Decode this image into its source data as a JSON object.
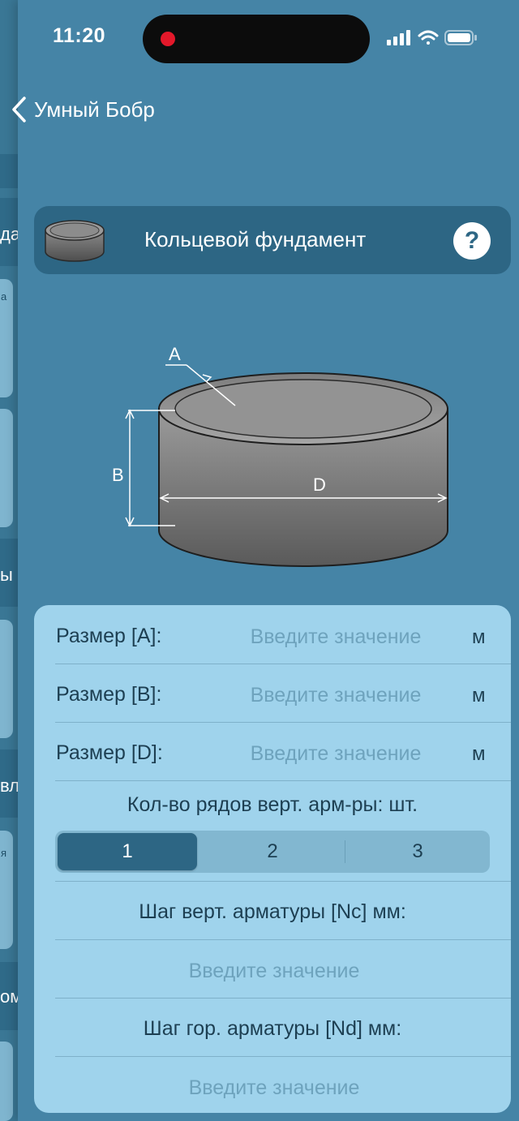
{
  "status_bar": {
    "time": "11:20"
  },
  "nav": {
    "back_label": "Умный Бобр"
  },
  "header": {
    "title": "Кольцевой фундамент",
    "help_label": "?"
  },
  "diagram": {
    "label_a": "A",
    "label_b": "B",
    "label_d": "D"
  },
  "underlying_screen": {
    "fragments": [
      "да",
      "а",
      "ы",
      "вл",
      "я",
      "ом"
    ]
  },
  "form": {
    "size_a": {
      "label": "Размер [A]:",
      "placeholder": "Введите значение",
      "unit": "м"
    },
    "size_b": {
      "label": "Размер [B]:",
      "placeholder": "Введите значение",
      "unit": "м"
    },
    "size_d": {
      "label": "Размер [D]:",
      "placeholder": "Введите значение",
      "unit": "м"
    },
    "rows_label": "Кол-во рядов верт. арм-ры: шт.",
    "rows_options": [
      "1",
      "2",
      "3"
    ],
    "rows_selected": "1",
    "vert_step_label": "Шаг верт. арматуры [Nc] мм:",
    "vert_step_placeholder": "Введите значение",
    "hor_step_label": "Шаг гор. арматуры [Nd] мм:",
    "hor_step_placeholder": "Введите значение"
  },
  "colors": {
    "background": "#4584a6",
    "card": "#2d6684",
    "form_bg": "#9fd3ec",
    "selected_segment": "#2d6684",
    "record_dot": "#e3182a"
  }
}
